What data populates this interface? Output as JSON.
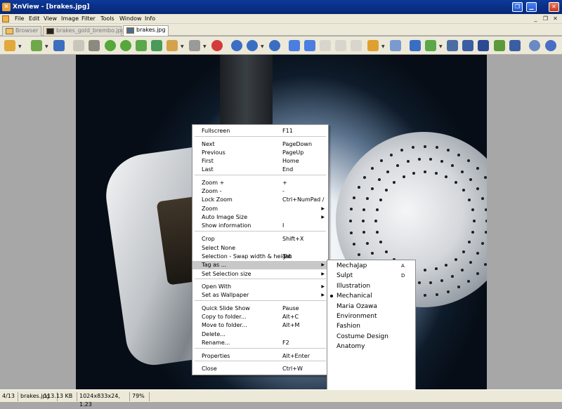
{
  "window": {
    "title": "XnView - [brakes.jpg]"
  },
  "menubar": {
    "items": [
      "File",
      "Edit",
      "View",
      "Image",
      "Filter",
      "Tools",
      "Window",
      "Info"
    ]
  },
  "tabs": [
    {
      "label": "Browser",
      "active": false
    },
    {
      "label": "brakes_gold_brembo.jpg",
      "active": false
    },
    {
      "label": "brakes.jpg",
      "active": true
    }
  ],
  "toolbar": {
    "icons": [
      "browser-tree-icon",
      "open-folder-icon",
      "save-icon",
      "undo-icon",
      "crop-icon",
      "rotate-left-icon",
      "rotate-right-icon",
      "export-icon",
      "image-export-icon",
      "batch-icon",
      "select-icon",
      "tag-icon",
      "zoom-in-icon",
      "zoom-icon",
      "zoom-out-icon",
      "previous-icon",
      "next-icon",
      "first-icon",
      "last-icon",
      "slideshow-icon",
      "screen-icon",
      "copy-icon",
      "fit-icon",
      "fullscreen-icon",
      "print-icon",
      "scanner-icon",
      "monitor-icon",
      "photos-icon",
      "camera-icon",
      "settings-icon",
      "help-icon"
    ]
  },
  "context_menu": {
    "items": [
      {
        "label": "Fullscreen",
        "shortcut": "F11"
      },
      {
        "label": "Next",
        "shortcut": "PageDown"
      },
      {
        "label": "Previous",
        "shortcut": "PageUp"
      },
      {
        "label": "First",
        "shortcut": "Home"
      },
      {
        "label": "Last",
        "shortcut": "End"
      },
      {
        "label": "Zoom +",
        "shortcut": "+"
      },
      {
        "label": "Zoom -",
        "shortcut": "-"
      },
      {
        "label": "Lock Zoom",
        "shortcut": "Ctrl+NumPad /"
      },
      {
        "label": "Zoom",
        "shortcut": ""
      },
      {
        "label": "Auto Image Size",
        "shortcut": ""
      },
      {
        "label": "Show information",
        "shortcut": "I"
      },
      {
        "label": "Crop",
        "shortcut": "Shift+X"
      },
      {
        "label": "Select None",
        "shortcut": ""
      },
      {
        "label": "Selection - Swap width & height",
        "shortcut": "Tab"
      },
      {
        "label": "Tag as ...",
        "shortcut": ""
      },
      {
        "label": "Set Selection size",
        "shortcut": ""
      },
      {
        "label": "Open With",
        "shortcut": ""
      },
      {
        "label": "Set as Wallpaper",
        "shortcut": ""
      },
      {
        "label": "Quick Slide Show",
        "shortcut": "Pause"
      },
      {
        "label": "Copy to folder...",
        "shortcut": "Alt+C"
      },
      {
        "label": "Move to folder...",
        "shortcut": "Alt+M"
      },
      {
        "label": "Delete...",
        "shortcut": ""
      },
      {
        "label": "Rename...",
        "shortcut": "F2"
      },
      {
        "label": "Properties",
        "shortcut": "Alt+Enter"
      },
      {
        "label": "Close",
        "shortcut": "Ctrl+W"
      }
    ]
  },
  "tag_submenu": {
    "items": [
      {
        "label": "MechaJap",
        "shortcut": "A",
        "checked": false
      },
      {
        "label": "Sulpt",
        "shortcut": "D",
        "checked": false
      },
      {
        "label": "Illustration",
        "shortcut": "",
        "checked": false
      },
      {
        "label": "Mechanical",
        "shortcut": "",
        "checked": true
      },
      {
        "label": "Maria Ozawa",
        "shortcut": "",
        "checked": false
      },
      {
        "label": "Environment",
        "shortcut": "",
        "checked": false
      },
      {
        "label": "Fashion",
        "shortcut": "",
        "checked": false
      },
      {
        "label": "Costume Design",
        "shortcut": "",
        "checked": false
      },
      {
        "label": "Anatomy",
        "shortcut": "",
        "checked": false
      }
    ]
  },
  "statusbar": {
    "index": "4/13",
    "filename": "brakes.jpg",
    "filesize": "113.13 KB",
    "dimensions": "1024x833x24, 1.23",
    "zoom": "79%"
  }
}
